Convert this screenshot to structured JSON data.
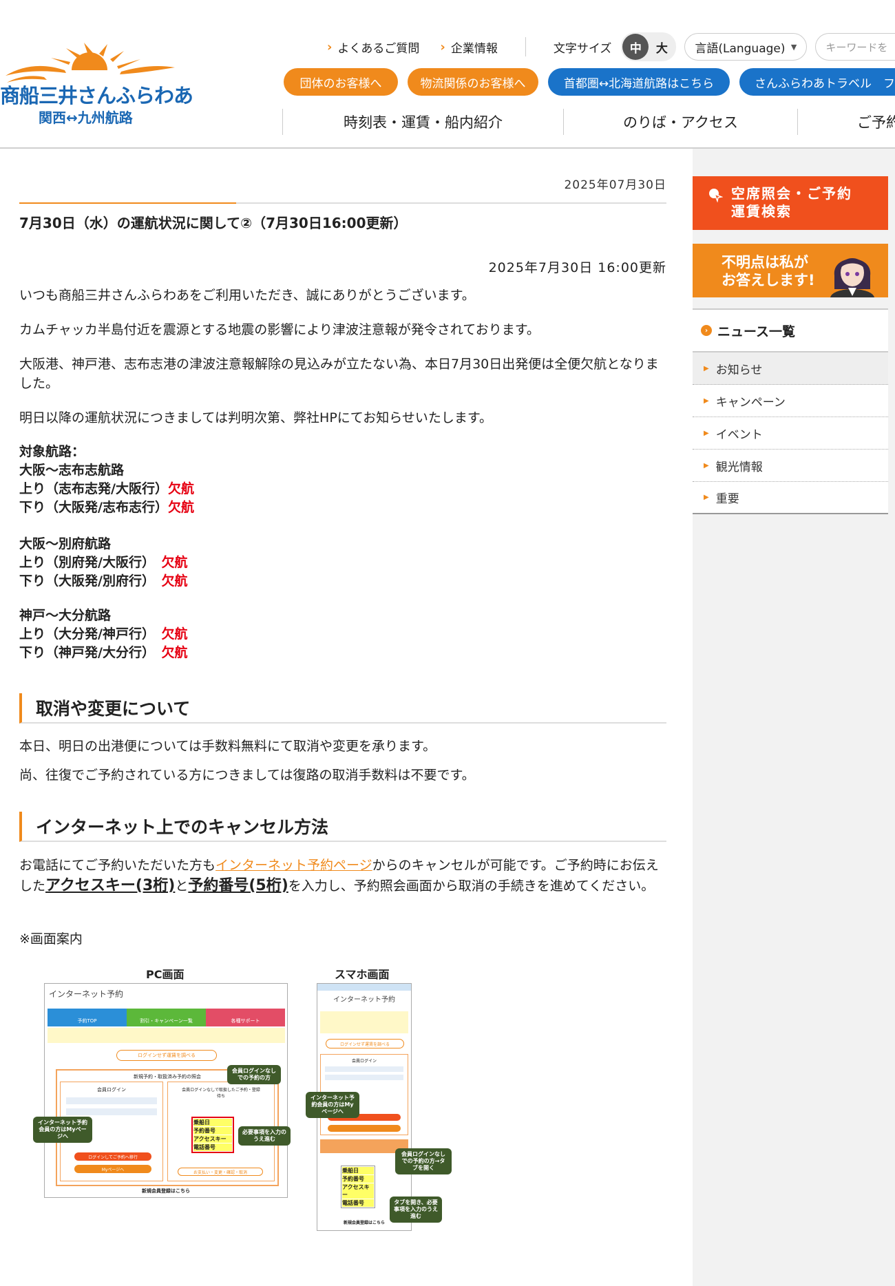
{
  "header": {
    "brand": "商船三井さんふらわあ",
    "route": "関西↔九州航路",
    "util_links": [
      "よくあるご質問",
      "企業情報"
    ],
    "font_size_label": "文字サイズ",
    "font_sizes": [
      "中",
      "大"
    ],
    "language_label": "言語(Language)",
    "keyword_placeholder": "キーワードを",
    "pills": [
      {
        "label": "団体のお客様へ",
        "color": "#f08a1c"
      },
      {
        "label": "物流関係のお客様へ",
        "color": "#f08a1c"
      },
      {
        "label": "首都圏↔北海道航路はこちら",
        "color": "#1a73c9"
      },
      {
        "label": "さんふらわあトラベル　フェ",
        "color": "#1a73c9"
      }
    ],
    "nav": [
      "時刻表・運賃・船内紹介",
      "のりば・アクセス",
      "ご予約"
    ]
  },
  "article": {
    "date": "2025年07月30日",
    "title": "7月30日（水）の運航状況に関して②（7月30日16:00更新）",
    "updated": "2025年7月30日 16:00更新",
    "p1": "いつも商船三井さんふらわあをご利用いただき、誠にありがとうございます。",
    "p2": "カムチャッカ半島付近を震源とする地震の影響により津波注意報が発令されております。",
    "p3": "大阪港、神戸港、志布志港の津波注意報解除の見込みが立たない為、本日7月30日出発便は全便欠航となりました。",
    "p4": "明日以降の運航状況につきましては判明次第、弊社HPにてお知らせいたします。",
    "target_label": "対象航路：",
    "routes": [
      {
        "name": "大阪～志布志航路",
        "rows": [
          {
            "dir": "上り（志布志発/大阪行）",
            "status": "欠航"
          },
          {
            "dir": "下り（大阪発/志布志行）",
            "status": "欠航"
          }
        ]
      },
      {
        "name": "大阪～別府航路",
        "rows": [
          {
            "dir": "上り（別府発/大阪行）　",
            "status": "欠航"
          },
          {
            "dir": "下り（大阪発/別府行）　",
            "status": "欠航"
          }
        ]
      },
      {
        "name": "神戸～大分航路",
        "rows": [
          {
            "dir": "上り（大分発/神戸行）　",
            "status": "欠航"
          },
          {
            "dir": "下り（神戸発/大分行）　",
            "status": "欠航"
          }
        ]
      }
    ],
    "h_cancel": "取消や変更について",
    "cancel_p1": "本日、明日の出港便については手数料無料にて取消や変更を承ります。",
    "cancel_p2": "尚、往復でご予約されている方につきましては復路の取消手数料は不要です。",
    "h_internet": "インターネット上でのキャンセル方法",
    "net_pre": "お電話にてご予約いただいた方も",
    "net_link": "インターネット予約ページ",
    "net_mid1": "からのキャンセルが可能です。ご予約時にお伝えした",
    "net_key": "アクセスキー(3桁)",
    "net_and": "と",
    "net_num": "予約番号(5桁)",
    "net_post": "を入力し、予約照会画面から取消の手続きを進めてください。",
    "guide_note": "※画面案内",
    "pc_label": "PC画面",
    "sp_label": "スマホ画面"
  },
  "guide": {
    "pc_header": "インターネット予約",
    "pc_tabs": [
      "予約TOP",
      "割引・キャンペーン一覧",
      "各種サポート"
    ],
    "pc_login_btn": "ログインせず運賃を調べる",
    "pc_new_title": "新規予約・取扱済み予約の照会",
    "pc_member_login": "会員ログイン",
    "pc_nonmember_title": "会員ログインなしで取扱したご予約・登録待ち",
    "pc_fields": [
      "乗船日",
      "予約番号",
      "アクセスキー",
      "電話番号"
    ],
    "pc_login_button": "ログインしてご予約へ移行",
    "pc_mypage_button": "Myページへ",
    "pc_search_button": "お支払い・変更・確認・取消",
    "pc_register": "新規会員登録はこちら",
    "callout_member": "インターネット予約会員の方はMyページへ",
    "callout_nonmember": "会員ログインなしでの予約の方",
    "callout_input": "必要事項を入力のうえ進む",
    "sp_header": "インターネット予約",
    "sp_login_btn": "ログインせず運賃を調べる",
    "sp_member_login": "会員ログイン",
    "sp_fields": [
      "乗船日",
      "予約番号",
      "アクセスキー",
      "電話番号"
    ],
    "sp_register": "新規会員登録はこちら",
    "sp_callout_member": "インターネット予約会員の方はMyページへ",
    "sp_callout_nonmember": "会員ログインなしでの予約の方→タブを開く",
    "sp_callout_input": "タブを開き、必要事項を入力のうえ進む"
  },
  "sidebar": {
    "vacancy": "空席照会・ご予約\n運賃検索",
    "vacancy_l1": "空席照会・ご予約",
    "vacancy_l2": "運賃検索",
    "faq_l1": "不明点は私が",
    "faq_l2": "お答えします!",
    "news_title": "ニュース一覧",
    "news_items": [
      "お知らせ",
      "キャンペーン",
      "イベント",
      "観光情報",
      "重要"
    ]
  },
  "colors": {
    "accent": "#f08a1c",
    "brand_blue": "#1a67b3",
    "alert_red": "#e60012",
    "vacancy_red": "#f0501d"
  }
}
